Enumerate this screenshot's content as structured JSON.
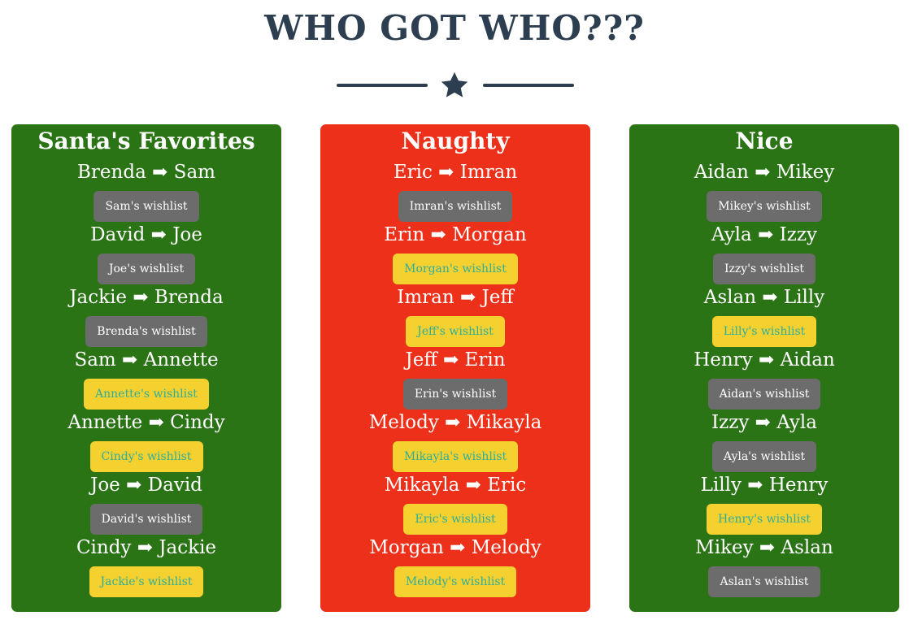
{
  "header": {
    "title": "WHO GOT WHO???"
  },
  "colors": {
    "title": "#2c3e50",
    "green": "#2a7416",
    "red": "#ed3019",
    "button_gray": "#6c6c6c",
    "button_yellow": "#f5d130",
    "yellow_text": "#2fae9a"
  },
  "divider_icon": "star-icon",
  "columns": [
    {
      "title": "Santa's Favorites",
      "color": "#2a7416",
      "pairs": [
        {
          "label": "Brenda ➡ Sam",
          "wishlist": "Sam's wishlist",
          "style": "gray"
        },
        {
          "label": "David ➡ Joe",
          "wishlist": "Joe's wishlist",
          "style": "gray"
        },
        {
          "label": "Jackie ➡ Brenda",
          "wishlist": "Brenda's wishlist",
          "style": "gray"
        },
        {
          "label": "Sam ➡ Annette",
          "wishlist": "Annette's wishlist",
          "style": "yellow"
        },
        {
          "label": "Annette ➡ Cindy",
          "wishlist": "Cindy's wishlist",
          "style": "yellow"
        },
        {
          "label": "Joe ➡ David",
          "wishlist": "David's wishlist",
          "style": "gray"
        },
        {
          "label": "Cindy ➡ Jackie",
          "wishlist": "Jackie's wishlist",
          "style": "yellow"
        }
      ]
    },
    {
      "title": "Naughty",
      "color": "#ed3019",
      "pairs": [
        {
          "label": "Eric ➡ Imran",
          "wishlist": "Imran's wishlist",
          "style": "gray"
        },
        {
          "label": "Erin ➡ Morgan",
          "wishlist": "Morgan's wishlist",
          "style": "yellow"
        },
        {
          "label": "Imran ➡ Jeff",
          "wishlist": "Jeff's wishlist",
          "style": "yellow"
        },
        {
          "label": "Jeff ➡ Erin",
          "wishlist": "Erin's wishlist",
          "style": "gray"
        },
        {
          "label": "Melody ➡ Mikayla",
          "wishlist": "Mikayla's wishlist",
          "style": "yellow"
        },
        {
          "label": "Mikayla ➡ Eric",
          "wishlist": "Eric's wishlist",
          "style": "yellow"
        },
        {
          "label": "Morgan ➡ Melody",
          "wishlist": "Melody's wishlist",
          "style": "yellow"
        }
      ]
    },
    {
      "title": "Nice",
      "color": "#2a7416",
      "pairs": [
        {
          "label": "Aidan ➡ Mikey",
          "wishlist": "Mikey's wishlist",
          "style": "gray"
        },
        {
          "label": "Ayla ➡ Izzy",
          "wishlist": "Izzy's wishlist",
          "style": "gray"
        },
        {
          "label": "Aslan ➡ Lilly",
          "wishlist": "Lilly's wishlist",
          "style": "yellow"
        },
        {
          "label": "Henry ➡ Aidan",
          "wishlist": "Aidan's wishlist",
          "style": "gray"
        },
        {
          "label": "Izzy ➡ Ayla",
          "wishlist": "Ayla's wishlist",
          "style": "gray"
        },
        {
          "label": "Lilly ➡ Henry",
          "wishlist": "Henry's wishlist",
          "style": "yellow"
        },
        {
          "label": "Mikey ➡ Aslan",
          "wishlist": "Aslan's wishlist",
          "style": "gray"
        }
      ]
    }
  ]
}
